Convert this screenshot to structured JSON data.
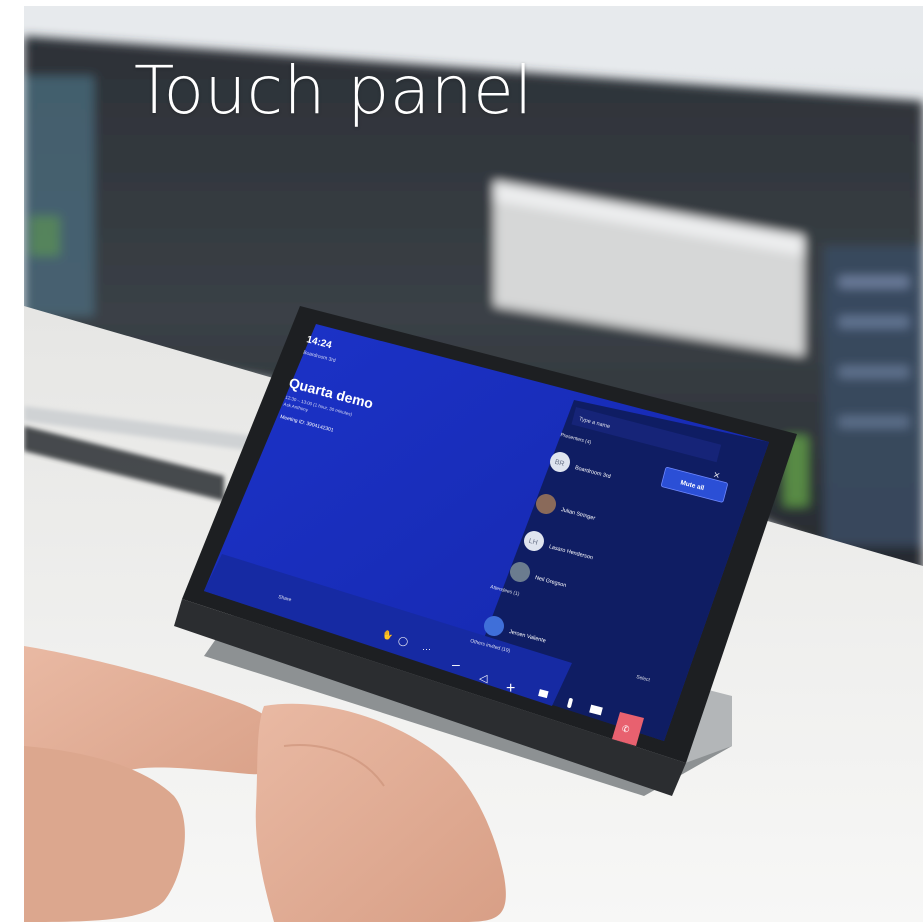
{
  "overlay": {
    "title": "Touch panel"
  },
  "device_screen": {
    "time": "14:24",
    "room": "Boardroom 3rd",
    "meeting_title": "Quarta demo",
    "meeting_time": "12:30 – 13:00 (1 hour, 30 minutes)",
    "organizer": "Ask Anthony",
    "meeting_id": "Meeting ID: 3904142301",
    "people_search_placeholder": "Type a name",
    "presenters_header": "Presenters (4)",
    "attendees_header": "Attendees (1)",
    "others_header": "Others invited (19)",
    "mute_all_label": "Mute all",
    "people": [
      {
        "initials": "BR",
        "name": "Boardroom 3rd"
      },
      {
        "initials": "",
        "name": "Julian Stringer"
      },
      {
        "initials": "LH",
        "name": "Lasaro Henderson"
      },
      {
        "initials": "",
        "name": "Neil Gregson"
      },
      {
        "initials": "",
        "name": "Jeroen Valiente"
      }
    ],
    "select_label": "Select",
    "share_label": "Share"
  },
  "colors": {
    "panel_blue": "#1a2fc2",
    "panel_dark": "#0e1a52",
    "end_call": "#e8616f",
    "mute_all_button": "#2b4fd6"
  }
}
